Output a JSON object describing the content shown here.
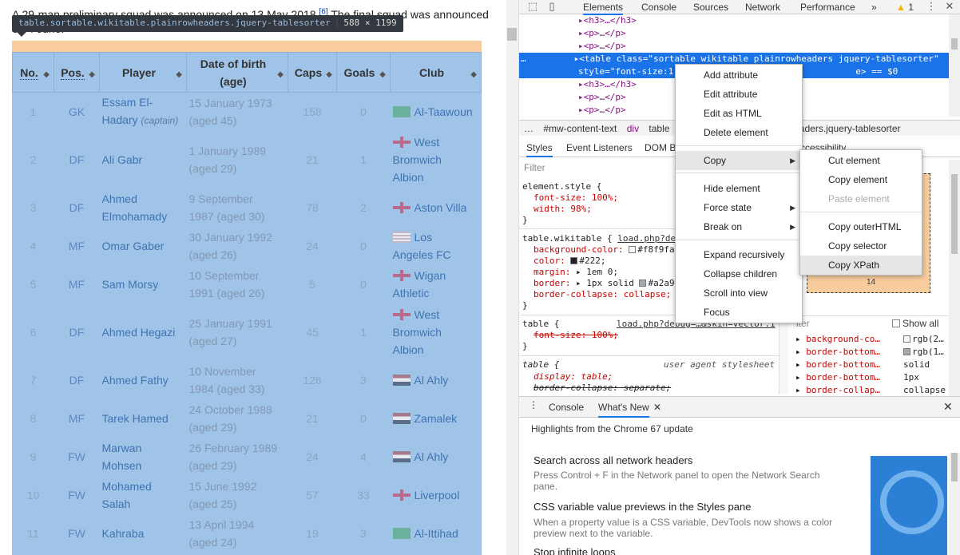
{
  "page": {
    "intro_a": "A 29-man preliminary squad was announced on 13 May 2018.",
    "intro_ref": "[6]",
    "intro_b": " The final squad was announced on 4 June.",
    "inspect_selector": "table.sortable.wikitable.plainrowheaders.jquery-tablesorter",
    "inspect_size": "588 × 1199",
    "headers": {
      "no": "No.",
      "pos": "Pos.",
      "player": "Player",
      "dob_line1": "Date of birth",
      "dob_line2": "(age)",
      "caps": "Caps",
      "goals": "Goals",
      "club": "Club"
    },
    "sort_arrow": "◆",
    "captain_note": "(captain)",
    "rows": [
      {
        "no": "1",
        "pos": "GK",
        "player_l1": "Essam El-",
        "player_l2": "Hadary",
        "dob_l1": "15 January 1973",
        "dob_l2": "(aged 45)",
        "caps": "158",
        "goals": "0",
        "flag": "sa",
        "club_l1": "Al-Taawoun",
        "club_l2": "",
        "club_l3": ""
      },
      {
        "no": "2",
        "pos": "DF",
        "player_l1": "Ali Gabr",
        "player_l2": "",
        "dob_l1": "1 January 1989",
        "dob_l2": "(aged 29)",
        "caps": "21",
        "goals": "1",
        "flag": "eng",
        "club_l1": "West",
        "club_l2": "Bromwich",
        "club_l3": "Albion"
      },
      {
        "no": "3",
        "pos": "DF",
        "player_l1": "Ahmed",
        "player_l2": "Elmohamady",
        "dob_l1": "9 September",
        "dob_l2": "1987 (aged 30)",
        "caps": "78",
        "goals": "2",
        "flag": "eng",
        "club_l1": "Aston Villa",
        "club_l2": "",
        "club_l3": ""
      },
      {
        "no": "4",
        "pos": "MF",
        "player_l1": "Omar Gaber",
        "player_l2": "",
        "dob_l1": "30 January 1992",
        "dob_l2": "(aged 26)",
        "caps": "24",
        "goals": "0",
        "flag": "us",
        "club_l1": "Los",
        "club_l2": "Angeles FC",
        "club_l3": ""
      },
      {
        "no": "5",
        "pos": "MF",
        "player_l1": "Sam Morsy",
        "player_l2": "",
        "dob_l1": "10 September",
        "dob_l2": "1991 (aged 26)",
        "caps": "5",
        "goals": "0",
        "flag": "eng",
        "club_l1": "Wigan",
        "club_l2": "Athletic",
        "club_l3": ""
      },
      {
        "no": "6",
        "pos": "DF",
        "player_l1": "Ahmed Hegazi",
        "player_l2": "",
        "dob_l1": "25 January 1991",
        "dob_l2": "(aged 27)",
        "caps": "45",
        "goals": "1",
        "flag": "eng",
        "club_l1": "West",
        "club_l2": "Bromwich",
        "club_l3": "Albion"
      },
      {
        "no": "7",
        "pos": "DF",
        "player_l1": "Ahmed Fathy",
        "player_l2": "",
        "dob_l1": "10 November",
        "dob_l2": "1984 (aged 33)",
        "caps": "126",
        "goals": "3",
        "flag": "eg",
        "club_l1": "Al Ahly",
        "club_l2": "",
        "club_l3": ""
      },
      {
        "no": "8",
        "pos": "MF",
        "player_l1": "Tarek Hamed",
        "player_l2": "",
        "dob_l1": "24 October 1988",
        "dob_l2": "(aged 29)",
        "caps": "21",
        "goals": "0",
        "flag": "eg",
        "club_l1": "Zamalek",
        "club_l2": "",
        "club_l3": ""
      },
      {
        "no": "9",
        "pos": "FW",
        "player_l1": "Marwan",
        "player_l2": "Mohsen",
        "dob_l1": "26 February 1989",
        "dob_l2": "(aged 29)",
        "caps": "24",
        "goals": "4",
        "flag": "eg",
        "club_l1": "Al Ahly",
        "club_l2": "",
        "club_l3": ""
      },
      {
        "no": "10",
        "pos": "FW",
        "player_l1": "Mohamed",
        "player_l2": "Salah",
        "dob_l1": "15 June 1992",
        "dob_l2": "(aged 25)",
        "caps": "57",
        "goals": "33",
        "flag": "eng",
        "club_l1": "Liverpool",
        "club_l2": "",
        "club_l3": ""
      },
      {
        "no": "11",
        "pos": "FW",
        "player_l1": "Kahraba",
        "player_l2": "",
        "dob_l1": "13 April 1994",
        "dob_l2": "(aged 24)",
        "caps": "19",
        "goals": "3",
        "flag": "sa",
        "club_l1": "Al-Ittihad",
        "club_l2": "",
        "club_l3": ""
      }
    ]
  },
  "devtools": {
    "tabs": [
      "Elements",
      "Console",
      "Sources",
      "Network",
      "Performance"
    ],
    "more": "»",
    "warning_count": "1",
    "kebab": "⋮",
    "close": "✕",
    "dom_lines": [
      "▸<h3>…</h3>",
      "▸<p>…</p>",
      "▸<p>…</p>",
      "▸<table class=\"sortable wikitable plainrowheaders jquery-tablesorter\"",
      "style=\"font-size:1",
      "e> == $0",
      "▸<h3>…</h3>",
      "▸<p>…</p>",
      "▸<p>…</p>"
    ],
    "dom_ellipsis": "…",
    "breadcrumbs": [
      "…",
      "#mw-content-text",
      "div",
      "table",
      "aders.jquery-tablesorter"
    ],
    "style_tabs": [
      "Styles",
      "Event Listeners",
      "DOM B",
      "ccessibility"
    ],
    "filter_placeholder": "Filter",
    "style_lines": [
      "element.style {",
      "font-size: 100%;",
      "width: 98%;",
      "}",
      "table.wikitable {",
      "load.php?deb",
      "background-color:",
      "#f8f9fa",
      "color:",
      "#222;",
      "margin:",
      "1em 0;",
      "border:",
      "1px solid",
      "#a2a9b",
      "border-collapse: collapse;",
      "}",
      "table {",
      "load.php?debug=…&skin=vector:1",
      "font-size: 100%;",
      "}",
      "table {",
      "user agent stylesheet",
      "display: table;",
      "border-collapse: separate;"
    ],
    "box_value": "14",
    "computed_filter": "lter",
    "show_all": "Show all",
    "computed": [
      {
        "name": "background-co…",
        "value": "rgb(2…"
      },
      {
        "name": "border-bottom…",
        "value": "rgb(1…"
      },
      {
        "name": "border-bottom…",
        "value": "solid"
      },
      {
        "name": "border-bottom…",
        "value": "1px"
      },
      {
        "name": "border-collap…",
        "value": "collapse"
      }
    ],
    "drawer_tabs": [
      "Console",
      "What's New"
    ],
    "drawer_heading": "Highlights from the Chrome 67 update",
    "news": [
      {
        "title": "Search across all network headers",
        "desc": "Press Control + F in the Network panel to open the Network Search pane."
      },
      {
        "title": "CSS variable value previews in the Styles pane",
        "desc": "When a property value is a CSS variable, DevTools now shows a color preview next to the variable."
      },
      {
        "title": "Stop infinite loops",
        "desc": ""
      }
    ]
  },
  "context_menu": {
    "items": [
      "Add attribute",
      "Edit attribute",
      "Edit as HTML",
      "Delete element",
      "Copy",
      "Hide element",
      "Force state",
      "Break on",
      "Expand recursively",
      "Collapse children",
      "Scroll into view",
      "Focus"
    ],
    "submenu": [
      "Cut element",
      "Copy element",
      "Paste element",
      "Copy outerHTML",
      "Copy selector",
      "Copy XPath"
    ]
  },
  "colors": {
    "selection": "#1a73e8",
    "highlight": "#a0c4e8",
    "margin": "#f9cc9d",
    "tag": "#881280",
    "prop": "#c80000"
  }
}
